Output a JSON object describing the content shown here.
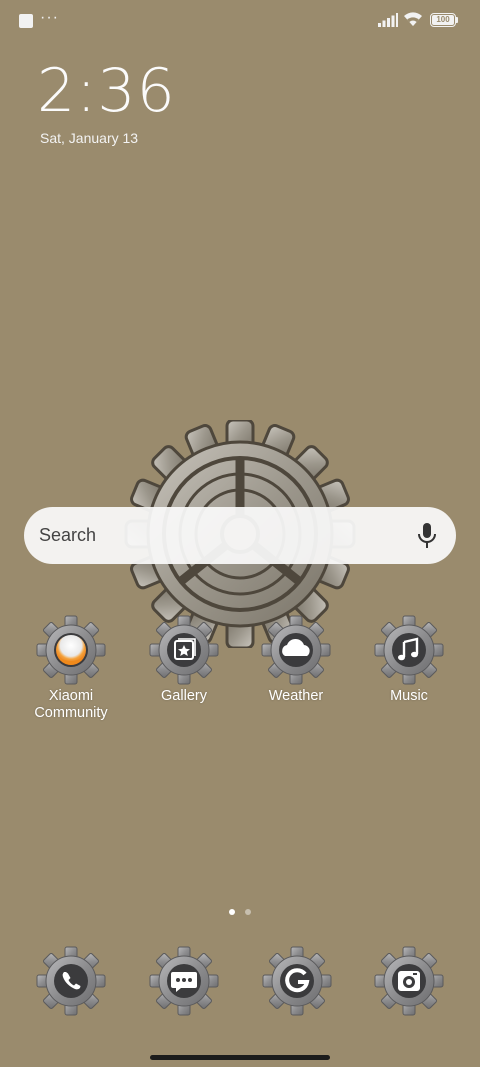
{
  "status_bar": {
    "overflow_dots": "···",
    "battery": "100"
  },
  "clock": {
    "time": "2:36",
    "date": "Sat, January 13"
  },
  "search": {
    "placeholder": "Search"
  },
  "apps": [
    {
      "label": "Xiaomi\nCommunity",
      "icon": "xiaomi-community-icon"
    },
    {
      "label": "Gallery",
      "icon": "gallery-icon"
    },
    {
      "label": "Weather",
      "icon": "weather-icon"
    },
    {
      "label": "Music",
      "icon": "music-icon"
    }
  ],
  "dock": [
    {
      "icon": "phone-icon"
    },
    {
      "icon": "messages-icon"
    },
    {
      "icon": "browser-icon"
    },
    {
      "icon": "camera-icon"
    }
  ],
  "pager": {
    "pages": 2,
    "current": 0
  },
  "colors": {
    "wallpaper": "#9a8b6d",
    "gear": "#8e8e90",
    "icon_core": "#3b3b3d",
    "accent_orange": "#f08a1c"
  }
}
